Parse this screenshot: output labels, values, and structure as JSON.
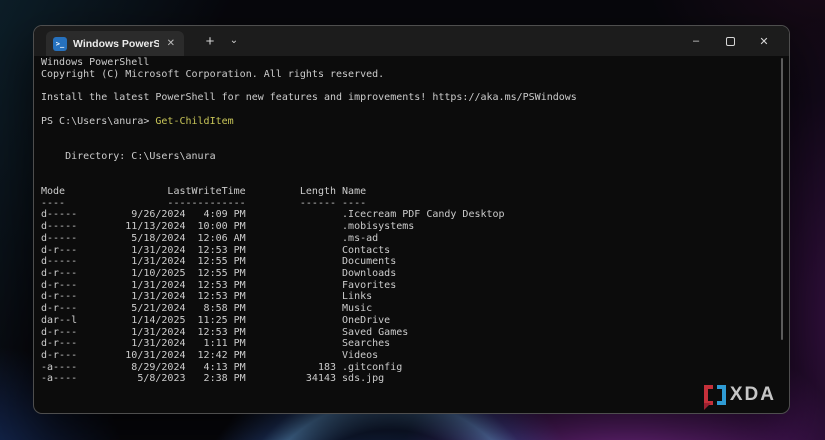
{
  "colors": {
    "terminal_background": "#0c0c0c",
    "terminal_text": "#cccccc",
    "command_highlight": "#c8c558",
    "titlebar_background": "#1c1c1c",
    "active_tab_background": "#2b2b2b",
    "powershell_icon_blue": "#2671be",
    "xda_red": "#c5303a",
    "xda_blue": "#2f9bd4"
  },
  "window": {
    "tab": {
      "title": "Windows PowerShell",
      "icon_glyph": ">_",
      "close_glyph": "✕"
    },
    "new_tab_glyph": "+",
    "tab_dropdown_glyph": "⌄",
    "controls": {
      "minimize_glyph": "–",
      "close_glyph": "✕"
    }
  },
  "terminal": {
    "banner": [
      "Windows PowerShell",
      "Copyright (C) Microsoft Corporation. All rights reserved."
    ],
    "update_notice": "Install the latest PowerShell for new features and improvements! https://aka.ms/PSWindows",
    "prompt": "PS C:\\Users\\anura>",
    "command": "Get-ChildItem",
    "directory_heading": "    Directory: C:\\Users\\anura",
    "listing": {
      "headers": [
        "Mode",
        "LastWriteTime",
        "Length",
        "Name"
      ],
      "rows": [
        {
          "mode": "d-----",
          "date": "9/26/2024",
          "time": "4:09 PM",
          "length": "",
          "name": ".Icecream PDF Candy Desktop"
        },
        {
          "mode": "d-----",
          "date": "11/13/2024",
          "time": "10:00 PM",
          "length": "",
          "name": ".mobisystems"
        },
        {
          "mode": "d-----",
          "date": "5/18/2024",
          "time": "12:06 AM",
          "length": "",
          "name": ".ms-ad"
        },
        {
          "mode": "d-r---",
          "date": "1/31/2024",
          "time": "12:53 PM",
          "length": "",
          "name": "Contacts"
        },
        {
          "mode": "d-----",
          "date": "1/31/2024",
          "time": "12:55 PM",
          "length": "",
          "name": "Documents"
        },
        {
          "mode": "d-r---",
          "date": "1/10/2025",
          "time": "12:55 PM",
          "length": "",
          "name": "Downloads"
        },
        {
          "mode": "d-r---",
          "date": "1/31/2024",
          "time": "12:53 PM",
          "length": "",
          "name": "Favorites"
        },
        {
          "mode": "d-r---",
          "date": "1/31/2024",
          "time": "12:53 PM",
          "length": "",
          "name": "Links"
        },
        {
          "mode": "d-r---",
          "date": "5/21/2024",
          "time": "8:58 PM",
          "length": "",
          "name": "Music"
        },
        {
          "mode": "dar--l",
          "date": "1/14/2025",
          "time": "11:25 PM",
          "length": "",
          "name": "OneDrive"
        },
        {
          "mode": "d-r---",
          "date": "1/31/2024",
          "time": "12:53 PM",
          "length": "",
          "name": "Saved Games"
        },
        {
          "mode": "d-r---",
          "date": "1/31/2024",
          "time": "1:11 PM",
          "length": "",
          "name": "Searches"
        },
        {
          "mode": "d-r---",
          "date": "10/31/2024",
          "time": "12:42 PM",
          "length": "",
          "name": "Videos"
        },
        {
          "mode": "-a----",
          "date": "8/29/2024",
          "time": "4:13 PM",
          "length": "183",
          "name": ".gitconfig"
        },
        {
          "mode": "-a----",
          "date": "5/8/2023",
          "time": "2:38 PM",
          "length": "34143",
          "name": "sds.jpg"
        }
      ]
    }
  },
  "watermark": {
    "text": "XDA"
  }
}
